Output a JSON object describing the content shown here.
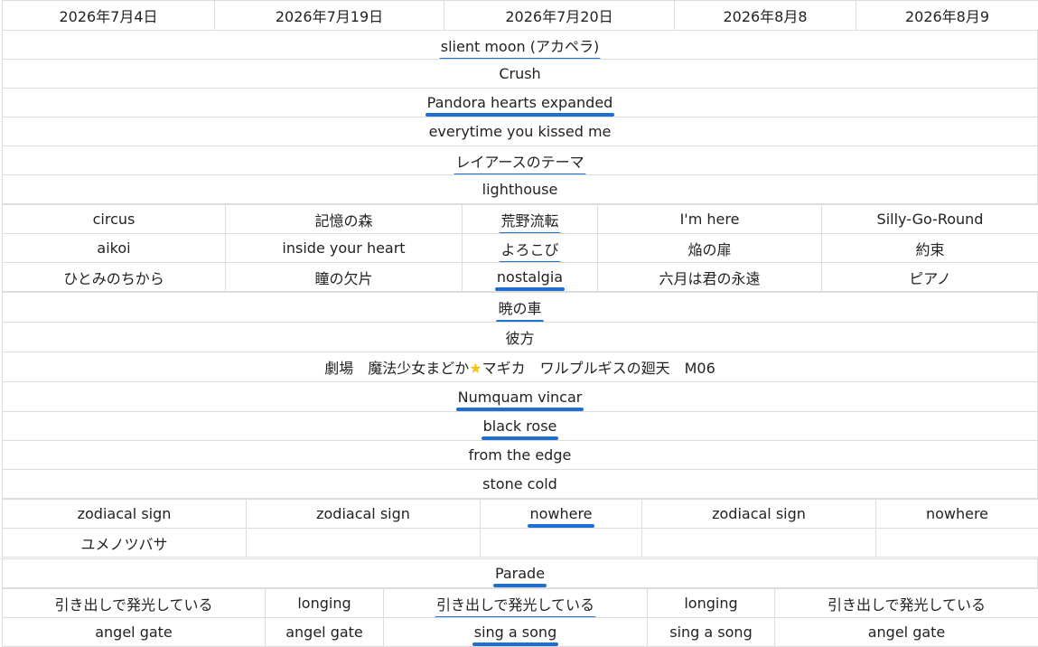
{
  "header": [
    "2026年7月4日",
    "2026年7月19日",
    "2026年7月20日",
    "2026年8月8",
    "2026年8月9"
  ],
  "block1": [
    {
      "text": "slient moon (アカペラ)",
      "hl": true
    },
    {
      "text": "Crush",
      "hl": false
    },
    {
      "text": "Pandora hearts expanded",
      "hl": true
    },
    {
      "text": "everytime you kissed me",
      "hl": false
    },
    {
      "text": "レイアースのテーマ",
      "hl": true
    },
    {
      "text": "lighthouse",
      "hl": false
    }
  ],
  "grid1": [
    [
      "circus",
      "記憶の森",
      "荒野流転",
      "I'm here",
      "Silly-Go-Round"
    ],
    [
      "aikoi",
      "inside your heart",
      "よろこび",
      "焔の扉",
      "約束"
    ],
    [
      "ひとみのちから",
      "瞳の欠片",
      "nostalgia",
      "六月は君の永遠",
      "ピアノ"
    ]
  ],
  "grid1_highlight_col": 2,
  "block2": [
    {
      "text": "暁の車",
      "hl": true
    },
    {
      "text": "彼方",
      "hl": false
    },
    {
      "text_before": "劇場　魔法少女まどか",
      "star": "★",
      "text_after": "マギカ　ワルプルギスの廻天　M06",
      "hl": false
    },
    {
      "text": "Numquam vincar",
      "hl": true
    },
    {
      "text": "black rose",
      "hl": true
    },
    {
      "text": "from the edge",
      "hl": false
    },
    {
      "text": "stone cold",
      "hl": false
    }
  ],
  "grid2": [
    [
      "zodiacal sign",
      "zodiacal sign",
      "nowhere",
      "zodiacal sign",
      "nowhere"
    ],
    [
      "ユメノツバサ",
      "",
      "",
      "",
      ""
    ]
  ],
  "grid2_highlight": [
    0,
    2
  ],
  "block3": [
    {
      "text": "Parade",
      "hl": true
    }
  ],
  "grid3": [
    [
      "引き出しで発光している",
      "longing",
      "引き出しで発光している",
      "longing",
      "引き出しで発光している"
    ],
    [
      "angel gate",
      "angel gate",
      "sing a song",
      "sing a song",
      "angel gate"
    ]
  ],
  "grid3_highlight_col": 2,
  "accent_color": "#1f6fd1"
}
